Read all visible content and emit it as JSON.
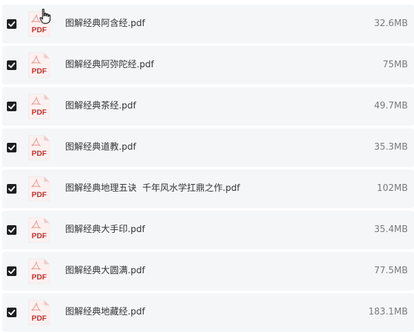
{
  "files": [
    {
      "name": "图解经典阿含经.pdf",
      "size": "32.6MB",
      "checked": true
    },
    {
      "name": "图解经典阿弥陀经.pdf",
      "size": "75MB",
      "checked": true
    },
    {
      "name": "图解经典茶经.pdf",
      "size": "49.7MB",
      "checked": true
    },
    {
      "name": "图解经典道教.pdf",
      "size": "35.3MB",
      "checked": true
    },
    {
      "name": "图解经典地理五诀  千年风水学扛鼎之作.pdf",
      "size": "102MB",
      "checked": true
    },
    {
      "name": "图解经典大手印.pdf",
      "size": "35.4MB",
      "checked": true
    },
    {
      "name": "图解经典大圆满.pdf",
      "size": "77.5MB",
      "checked": true
    },
    {
      "name": "图解经典地藏经.pdf",
      "size": "183.1MB",
      "checked": true
    }
  ],
  "icon": {
    "label": "PDF",
    "color": "#c9302c"
  },
  "colors": {
    "row_bg": "#f5f6f8",
    "checkbox": "#1f1f1f"
  }
}
